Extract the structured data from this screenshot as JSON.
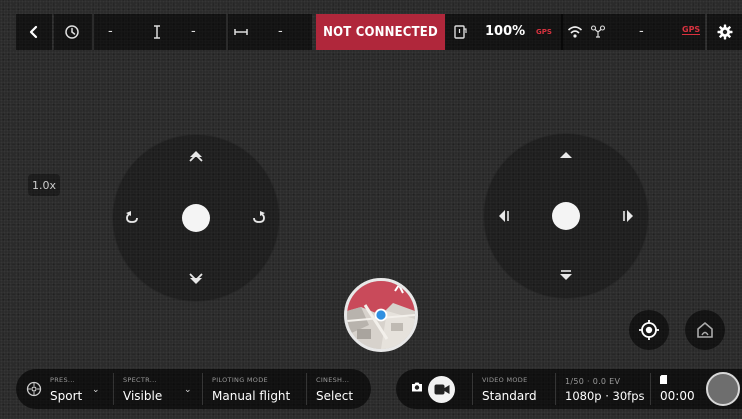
{
  "topbar": {
    "dash": "-",
    "status": "NOT CONNECTED",
    "battery": "100%",
    "gps_small": "GPS",
    "gps_drone": "GPS"
  },
  "zoom": "1.0x",
  "bottom": {
    "preset_label": "PRES...",
    "preset_value": "Sport",
    "spectrum_label": "SPECTR...",
    "spectrum_value": "Visible",
    "piloting_label": "PILOTING MODE",
    "piloting_value": "Manual flight",
    "cinesh_label": "CINESH...",
    "cinesh_value": "Select",
    "video_mode_label": "VIDEO MODE",
    "video_mode_value": "Standard",
    "exposure_label": "1/50 · 0.0 EV",
    "resolution_value": "1080p · 30fps",
    "timer_value": "00:00"
  },
  "colors": {
    "accent_red": "#b0273b",
    "gps_red": "#d8323f",
    "location_blue": "#2f8fe0"
  }
}
